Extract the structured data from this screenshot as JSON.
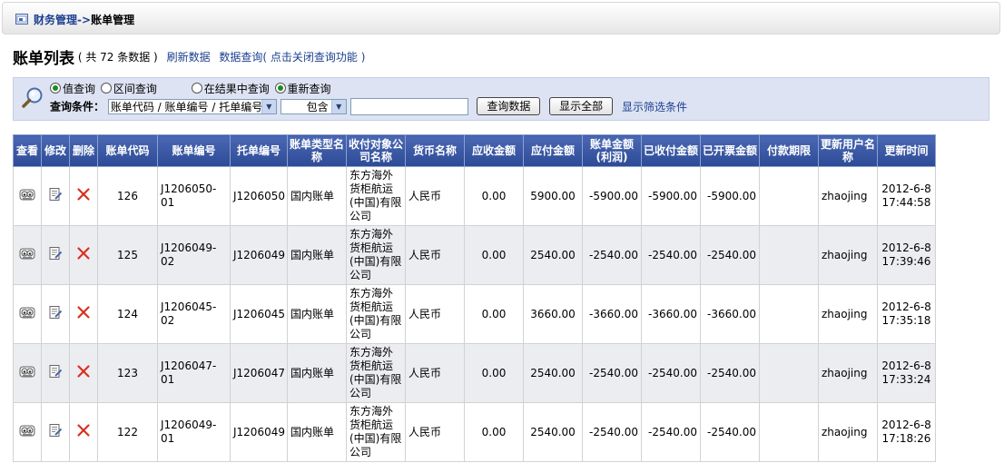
{
  "breadcrumb": {
    "section": "财务管理",
    "separator": "->",
    "current": "账单管理"
  },
  "list_header": {
    "title": "账单列表",
    "count_text": "( 共 72 条数据 )",
    "refresh_link": "刷新数据",
    "query_link": "数据查询",
    "close_query_link": "( 点击关闭查询功能 )"
  },
  "query": {
    "radios": [
      {
        "label": "值查询",
        "checked": true
      },
      {
        "label": "区间查询",
        "checked": false
      },
      {
        "label": "在结果中查询",
        "checked": false
      },
      {
        "label": "重新查询",
        "checked": true
      }
    ],
    "condition_label": "查询条件：",
    "field_select": "账单代码 / 账单编号 / 托单编号",
    "operator_select": "包含",
    "value": "",
    "search_button": "查询数据",
    "show_all_button": "显示全部",
    "filter_link": "显示筛选条件"
  },
  "table": {
    "headers": [
      "查看",
      "修改",
      "删除",
      "账单代码",
      "账单编号",
      "托单编号",
      "账单类型名称",
      "收付对象公司名称",
      "货币名称",
      "应收金额",
      "应付金额",
      "账单金额(利润)",
      "已收付金额",
      "已开票金额",
      "付款期限",
      "更新用户名称",
      "更新时间"
    ],
    "rows": [
      {
        "code": "126",
        "bill_no": "J1206050-01",
        "consign_no": "J1206050",
        "type": "国内账单",
        "company": "东方海外货柜航运(中国)有限公司",
        "currency": "人民币",
        "receivable": "0.00",
        "payable": "5900.00",
        "profit": "-5900.00",
        "paid": "-5900.00",
        "invoiced": "-5900.00",
        "term": "",
        "user": "zhaojing",
        "date": "2012-6-8",
        "time": "17:44:58"
      },
      {
        "code": "125",
        "bill_no": "J1206049-02",
        "consign_no": "J1206049",
        "type": "国内账单",
        "company": "东方海外货柜航运(中国)有限公司",
        "currency": "人民币",
        "receivable": "0.00",
        "payable": "2540.00",
        "profit": "-2540.00",
        "paid": "-2540.00",
        "invoiced": "-2540.00",
        "term": "",
        "user": "zhaojing",
        "date": "2012-6-8",
        "time": "17:39:46"
      },
      {
        "code": "124",
        "bill_no": "J1206045-02",
        "consign_no": "J1206045",
        "type": "国内账单",
        "company": "东方海外货柜航运(中国)有限公司",
        "currency": "人民币",
        "receivable": "0.00",
        "payable": "3660.00",
        "profit": "-3660.00",
        "paid": "-3660.00",
        "invoiced": "-3660.00",
        "term": "",
        "user": "zhaojing",
        "date": "2012-6-8",
        "time": "17:35:18"
      },
      {
        "code": "123",
        "bill_no": "J1206047-01",
        "consign_no": "J1206047",
        "type": "国内账单",
        "company": "东方海外货柜航运(中国)有限公司",
        "currency": "人民币",
        "receivable": "0.00",
        "payable": "2540.00",
        "profit": "-2540.00",
        "paid": "-2540.00",
        "invoiced": "-2540.00",
        "term": "",
        "user": "zhaojing",
        "date": "2012-6-8",
        "time": "17:33:24"
      },
      {
        "code": "122",
        "bill_no": "J1206049-01",
        "consign_no": "J1206049",
        "type": "国内账单",
        "company": "东方海外货柜航运(中国)有限公司",
        "currency": "人民币",
        "receivable": "0.00",
        "payable": "2540.00",
        "profit": "-2540.00",
        "paid": "-2540.00",
        "invoiced": "-2540.00",
        "term": "",
        "user": "zhaojing",
        "date": "2012-6-8",
        "time": "17:18:26"
      }
    ]
  },
  "icons": {
    "view": "view-icon",
    "edit": "edit-icon",
    "delete": "delete-icon",
    "search": "magnifier-icon",
    "breadcrumb": "folder-icon"
  },
  "colors": {
    "header_bg": "#2c4a95",
    "link": "#1b3f8f",
    "query_bg": "#dde3f3",
    "delete": "#d9301e"
  }
}
